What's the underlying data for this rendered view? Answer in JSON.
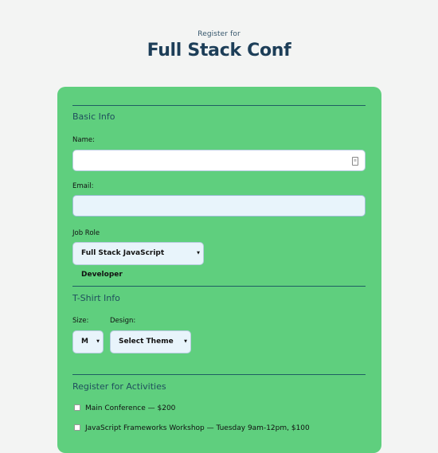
{
  "header": {
    "subtitle": "Register for",
    "title": "Full Stack Conf"
  },
  "basic_info": {
    "section_title": "Basic Info",
    "name_label": "Name:",
    "name_value": "",
    "email_label": "Email:",
    "email_value": "",
    "job_role_label": "Job Role",
    "job_role_selected": "Full Stack JavaScript Developer"
  },
  "tshirt_info": {
    "section_title": "T-Shirt Info",
    "size_label": "Size:",
    "size_selected": "M",
    "design_label": "Design:",
    "design_selected": "Select Theme"
  },
  "activities": {
    "section_title": "Register for Activities",
    "items": [
      {
        "label": "Main Conference — $200",
        "checked": false
      },
      {
        "label": "JavaScript Frameworks Workshop — Tuesday 9am-12pm, $100",
        "checked": false
      }
    ]
  },
  "colors": {
    "page_background": "#f3f4f3",
    "card_background": "#5fcf7e",
    "title_color": "#1d3e58",
    "field_background": "#e8f4fb"
  },
  "icons": {
    "select_arrow": "chevron-down-icon",
    "name_field_icon": "autofill-icon"
  }
}
